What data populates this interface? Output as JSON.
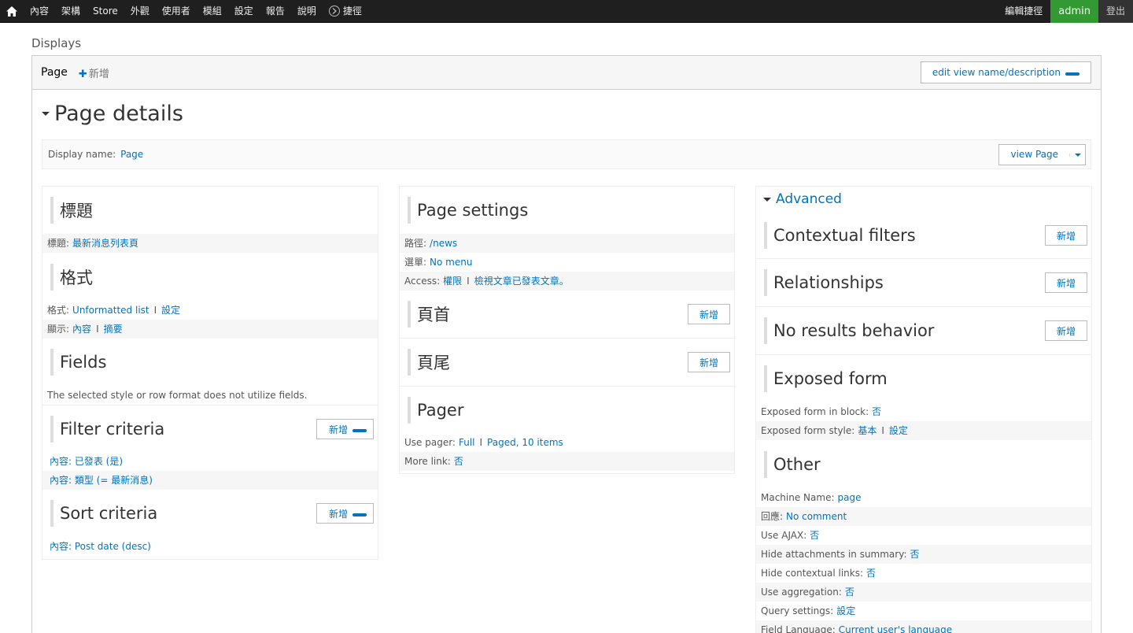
{
  "toolbar": {
    "menu": [
      "內容",
      "架構",
      "Store",
      "外觀",
      "使用者",
      "模組",
      "設定",
      "報告",
      "說明"
    ],
    "shortcuts": "捷徑",
    "edit_shortcuts": "編輯捷徑",
    "admin": "admin",
    "logout": "登出"
  },
  "displays_label": "Displays",
  "tabs": {
    "page": "Page",
    "add": "新增",
    "edit_view": "edit view name/description"
  },
  "page_details": {
    "heading": "Page details",
    "display_name_label": "Display name:",
    "display_name_value": "Page",
    "view_page": "view Page"
  },
  "col1": {
    "title_section": {
      "title": "標題",
      "rows": [
        {
          "label": "標題:",
          "value": "最新消息列表頁"
        }
      ]
    },
    "format_section": {
      "title": "格式",
      "format_label": "格式:",
      "format_value": "Unformatted list",
      "format_settings": "設定",
      "show_label": "顯示:",
      "show_value": "內容",
      "show_settings": "摘要"
    },
    "fields_section": {
      "title": "Fields",
      "note": "The selected style or row format does not utilize fields."
    },
    "filter_section": {
      "title": "Filter criteria",
      "add": "新增",
      "rows": [
        "內容: 已發表 (是)",
        "內容: 類型 (= 最新消息)"
      ]
    },
    "sort_section": {
      "title": "Sort criteria",
      "add": "新增",
      "rows": [
        "內容: Post date (desc)"
      ]
    }
  },
  "col2": {
    "page_settings": {
      "title": "Page settings",
      "path_label": "路徑:",
      "path_value": "/news",
      "menu_label": "選單:",
      "menu_value": "No menu",
      "access_label": "Access:",
      "access_value": "權限",
      "access_detail": "檢視文章已發表文章。"
    },
    "header": {
      "title": "頁首",
      "add": "新增"
    },
    "footer": {
      "title": "頁尾",
      "add": "新增"
    },
    "pager": {
      "title": "Pager",
      "use_pager_label": "Use pager:",
      "use_pager_value": "Full",
      "use_pager_detail": "Paged, 10 items",
      "more_link_label": "More link:",
      "more_link_value": "否"
    }
  },
  "col3": {
    "advanced": "Advanced",
    "contextual": {
      "title": "Contextual filters",
      "add": "新增"
    },
    "relationships": {
      "title": "Relationships",
      "add": "新增"
    },
    "no_results": {
      "title": "No results behavior",
      "add": "新增"
    },
    "exposed_form": {
      "title": "Exposed form",
      "in_block_label": "Exposed form in block:",
      "in_block_value": "否",
      "style_label": "Exposed form style:",
      "style_value": "基本",
      "style_settings": "設定"
    },
    "other": {
      "title": "Other",
      "rows": [
        {
          "label": "Machine Name:",
          "value": "page"
        },
        {
          "label": "回應:",
          "value": "No comment"
        },
        {
          "label": "Use AJAX:",
          "value": "否"
        },
        {
          "label": "Hide attachments in summary:",
          "value": "否"
        },
        {
          "label": "Hide contextual links:",
          "value": "否"
        },
        {
          "label": "Use aggregation:",
          "value": "否"
        },
        {
          "label": "Query settings:",
          "value": "設定"
        },
        {
          "label": "Field Language:",
          "value": "Current user's language"
        }
      ]
    }
  },
  "colors": {
    "link": "#0074bd",
    "admin": "#339933",
    "toolbar": "#1f1f1f"
  }
}
